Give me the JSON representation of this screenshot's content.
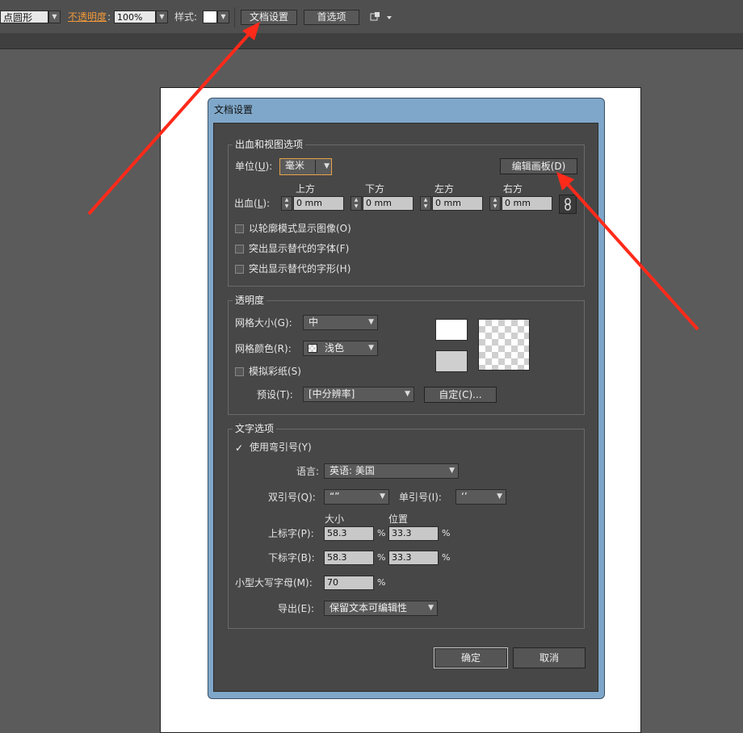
{
  "toolbar": {
    "brush_value": "点圆形",
    "opacity_label": "不透明度",
    "opacity_colon": ":",
    "opacity_value": "100%",
    "style_label": "样式:",
    "doc_setup_button": "文档设置",
    "preferences_button": "首选项",
    "colors": {
      "background": "#4f4f4f",
      "opacity_label": "#f29a3a"
    }
  },
  "dialog": {
    "title": "文档设置",
    "bleed_section": {
      "legend": "出血和视图选项",
      "unit_label": "单位(",
      "unit_key": "U",
      "unit_close": "):",
      "unit_value": "毫米",
      "edit_artboards_button": "编辑画板(D)",
      "bleed_label": "出血(",
      "bleed_key": "L",
      "bleed_close": "):",
      "bleed": [
        {
          "label": "上方",
          "value": "0 mm"
        },
        {
          "label": "下方",
          "value": "0 mm"
        },
        {
          "label": "左方",
          "value": "0 mm"
        },
        {
          "label": "右方",
          "value": "0 mm"
        }
      ],
      "checkboxes": [
        {
          "label": "以轮廓模式显示图像(O)",
          "checked": false
        },
        {
          "label": "突出显示替代的字体(F)",
          "checked": false
        },
        {
          "label": "突出显示替代的字形(H)",
          "checked": false
        }
      ]
    },
    "transparency_section": {
      "legend": "透明度",
      "grid_size_label": "网格大小(G):",
      "grid_size_value": "中",
      "grid_color_label": "网格颜色(R):",
      "grid_color_value": "浅色",
      "simulate_paper_label": "模拟彩纸(S)",
      "simulate_paper_checked": false,
      "preset_label": "预设(T):",
      "preset_value": "[中分辨率]",
      "custom_button": "自定(C)..."
    },
    "type_section": {
      "legend": "文字选项",
      "smart_quotes_label": "使用弯引号(Y)",
      "smart_quotes_checked": true,
      "language_label": "语言:",
      "language_value": "英语: 美国",
      "double_quotes_label": "双引号(Q):",
      "double_quotes_value": "“”",
      "single_quotes_label": "单引号(I):",
      "single_quotes_value": "‘’",
      "size_header": "大小",
      "position_header": "位置",
      "superscript_label": "上标字(P):",
      "superscript_size": "58.3",
      "superscript_position": "33.3",
      "subscript_label": "下标字(B):",
      "subscript_size": "58.3",
      "subscript_position": "33.3",
      "small_caps_label": "小型大写字母(M):",
      "small_caps_value": "70",
      "percent": "%",
      "export_label": "导出(E):",
      "export_value": "保留文本可编辑性"
    },
    "ok_button": "确定",
    "cancel_button": "取消"
  },
  "annotation_color": "#ff2a1a"
}
